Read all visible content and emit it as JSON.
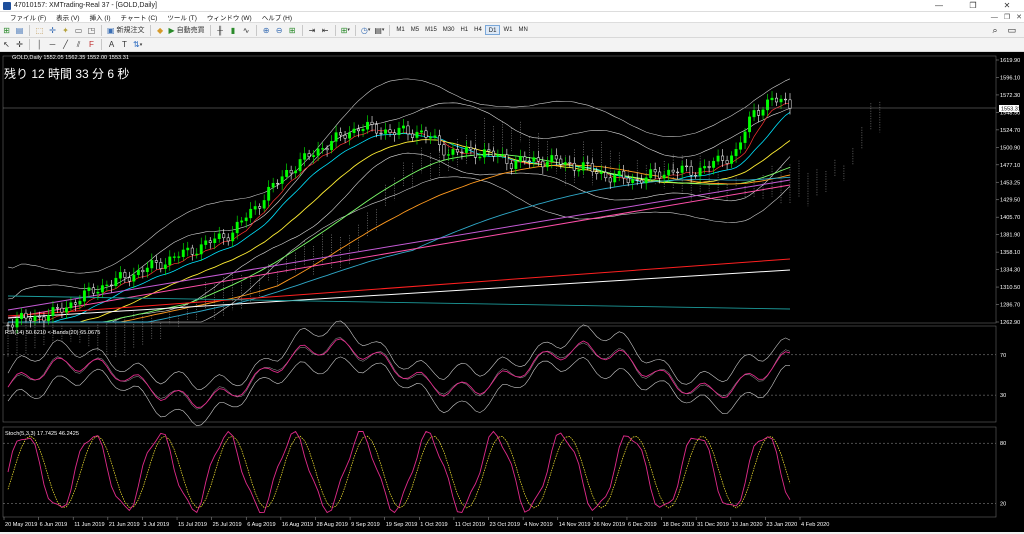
{
  "window": {
    "title": "47010157: XMTrading-Real 37 - [GOLD,Daily]",
    "controls": [
      "—",
      "❐",
      "✕"
    ]
  },
  "menu": [
    {
      "label": "ファイル (F)"
    },
    {
      "label": "表示 (V)"
    },
    {
      "label": "挿入 (I)"
    },
    {
      "label": "チャート (C)"
    },
    {
      "label": "ツール (T)"
    },
    {
      "label": "ウィンドウ (W)"
    },
    {
      "label": "ヘルプ (H)"
    }
  ],
  "mdi_controls": [
    "—",
    "❐",
    "✕"
  ],
  "toolbar": {
    "new_order": "新規注文",
    "auto_trading": "自動売買",
    "timeframes": [
      "M1",
      "M5",
      "M15",
      "M30",
      "H1",
      "H4",
      "D1",
      "W1",
      "MN"
    ],
    "active_timeframe": "D1"
  },
  "chart": {
    "symbol_header": "GOLD,Daily  1552.05 1562.35 1552.00 1553.31",
    "countdown": "残り 12 時間 33 分 6 秒",
    "current_price": "1553.31",
    "price_labels": [
      "1619.90",
      "1596.10",
      "1572.30",
      "1548.50",
      "1524.70",
      "1500.90",
      "1477.10",
      "1453.25",
      "1429.50",
      "1405.70",
      "1381.90",
      "1358.10",
      "1334.30",
      "1310.50",
      "1286.70",
      "1262.90"
    ],
    "date_labels": [
      "20 May 2019",
      "6 Jun 2019",
      "11 Jun 2019",
      "21 Jun 2019",
      "3 Jul 2019",
      "15 Jul 2019",
      "25 Jul 2019",
      "6 Aug 2019",
      "16 Aug 2019",
      "28 Aug 2019",
      "9 Sep 2019",
      "19 Sep 2019",
      "1 Oct 2019",
      "11 Oct 2019",
      "23 Oct 2019",
      "4 Nov 2019",
      "14 Nov 2019",
      "26 Nov 2019",
      "6 Dec 2019",
      "18 Dec 2019",
      "31 Dec 2019",
      "13 Jan 2020",
      "23 Jan 2020",
      "4 Feb 2020"
    ],
    "colors": {
      "bull": "#00ff00",
      "bear": "#ffffff",
      "grid": "#555555"
    }
  },
  "rsi": {
    "header": "RSI(14) 50.6210  <-Bands(20) 65.0675",
    "levels": [
      "70",
      "30"
    ]
  },
  "stoch": {
    "header": "Stoch(5,3,3) 17.7425 46.2425",
    "levels": [
      "80",
      "20"
    ]
  }
}
